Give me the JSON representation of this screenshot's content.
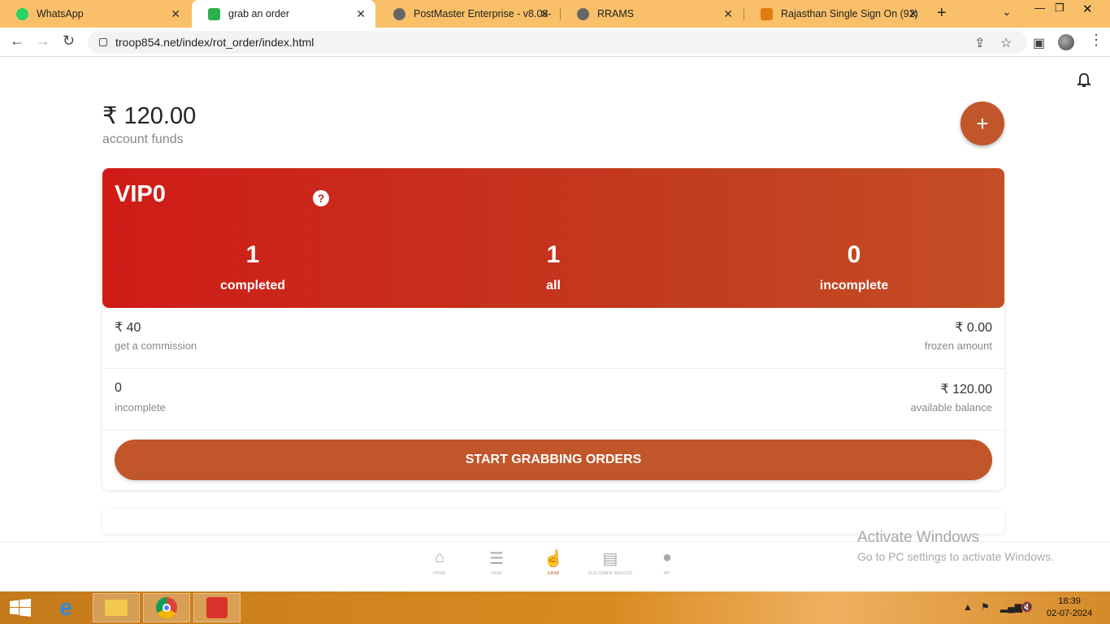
{
  "browser": {
    "tabs": [
      {
        "title": "WhatsApp",
        "active": false
      },
      {
        "title": "grab an order",
        "active": true
      },
      {
        "title": "PostMaster Enterprise - v8.08-",
        "active": false
      },
      {
        "title": "RRAMS",
        "active": false
      },
      {
        "title": "Rajasthan Single Sign On (92)",
        "active": false
      }
    ],
    "url": "troop854.net/index/rot_order/index.html"
  },
  "account": {
    "amount": "₹ 120.00",
    "label": "account funds"
  },
  "vip": {
    "level": "VIP0",
    "stats": [
      {
        "value": "1",
        "label": "completed"
      },
      {
        "value": "1",
        "label": "all"
      },
      {
        "value": "0",
        "label": "incomplete"
      }
    ]
  },
  "info": {
    "commission_value": "₹ 40",
    "commission_label": "get a commission",
    "frozen_value": "₹ 0.00",
    "frozen_label": "frozen amount",
    "incomplete_value": "0",
    "incomplete_label": "incomplete",
    "available_value": "₹ 120.00",
    "available_label": "available balance"
  },
  "start_button": "START GRABBING ORDERS",
  "bottom_nav": [
    {
      "label": "HOME",
      "icon": "home-icon"
    },
    {
      "label": "TASK",
      "icon": "task-list-icon"
    },
    {
      "label": "GRAB",
      "icon": "grab-hand-icon"
    },
    {
      "label": "CUSTOMER SERVICE",
      "icon": "chat-icon"
    },
    {
      "label": "MY",
      "icon": "user-icon"
    }
  ],
  "watermark": {
    "line1": "Activate Windows",
    "line2": "Go to PC settings to activate Windows."
  },
  "taskbar": {
    "time": "18:39",
    "date": "02-07-2024"
  },
  "colors": {
    "accent": "#c0562a",
    "vip_gradient_start": "#d01b17",
    "vip_gradient_end": "#c44e25",
    "tab_strip": "#f9c069"
  }
}
